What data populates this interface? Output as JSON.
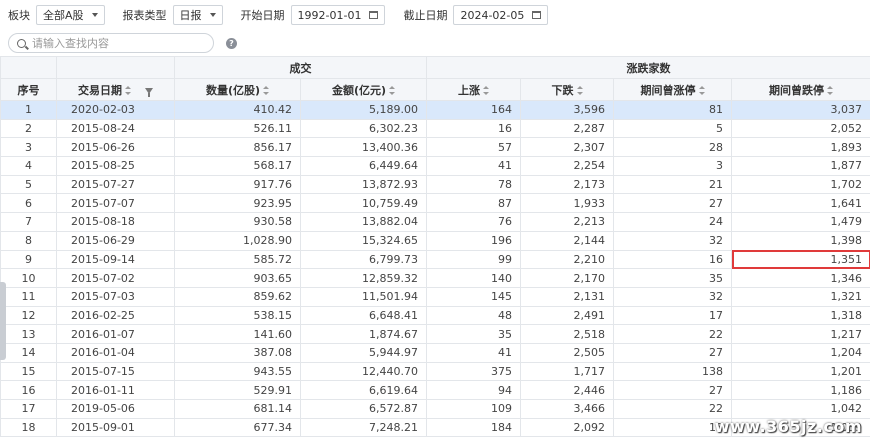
{
  "filters": {
    "board_label": "板块",
    "board_value": "全部A股",
    "report_type_label": "报表类型",
    "report_type_value": "日报",
    "start_label": "开始日期",
    "start_value": "1992-01-01",
    "end_label": "截止日期",
    "end_value": "2024-02-05"
  },
  "search": {
    "placeholder": "请输入查找内容",
    "value": ""
  },
  "help_glyph": "?",
  "headers": {
    "group_trade": "成交",
    "group_updown": "涨跌家数",
    "idx": "序号",
    "date": "交易日期",
    "volume": "数量(亿股)",
    "amount": "金额(亿元)",
    "up": "上涨",
    "down": "下跌",
    "limit_up": "期间曾涨停",
    "limit_down": "期间曾跌停"
  },
  "rows": [
    {
      "idx": "1",
      "date": "2020-02-03",
      "volume": "410.42",
      "amount": "5,189.00",
      "up": "164",
      "down": "3,596",
      "limit_up": "81",
      "limit_down": "3,037"
    },
    {
      "idx": "2",
      "date": "2015-08-24",
      "volume": "526.11",
      "amount": "6,302.23",
      "up": "16",
      "down": "2,287",
      "limit_up": "5",
      "limit_down": "2,052"
    },
    {
      "idx": "3",
      "date": "2015-06-26",
      "volume": "856.17",
      "amount": "13,400.36",
      "up": "57",
      "down": "2,307",
      "limit_up": "28",
      "limit_down": "1,893"
    },
    {
      "idx": "4",
      "date": "2015-08-25",
      "volume": "568.17",
      "amount": "6,449.64",
      "up": "41",
      "down": "2,254",
      "limit_up": "3",
      "limit_down": "1,877"
    },
    {
      "idx": "5",
      "date": "2015-07-27",
      "volume": "917.76",
      "amount": "13,872.93",
      "up": "78",
      "down": "2,173",
      "limit_up": "21",
      "limit_down": "1,702"
    },
    {
      "idx": "6",
      "date": "2015-07-07",
      "volume": "923.95",
      "amount": "10,759.49",
      "up": "87",
      "down": "1,933",
      "limit_up": "27",
      "limit_down": "1,641"
    },
    {
      "idx": "7",
      "date": "2015-08-18",
      "volume": "930.58",
      "amount": "13,882.04",
      "up": "76",
      "down": "2,213",
      "limit_up": "24",
      "limit_down": "1,479"
    },
    {
      "idx": "8",
      "date": "2015-06-29",
      "volume": "1,028.90",
      "amount": "15,324.65",
      "up": "196",
      "down": "2,144",
      "limit_up": "32",
      "limit_down": "1,398"
    },
    {
      "idx": "9",
      "date": "2015-09-14",
      "volume": "585.72",
      "amount": "6,799.73",
      "up": "99",
      "down": "2,210",
      "limit_up": "16",
      "limit_down": "1,351"
    },
    {
      "idx": "10",
      "date": "2015-07-02",
      "volume": "903.65",
      "amount": "12,859.32",
      "up": "140",
      "down": "2,170",
      "limit_up": "35",
      "limit_down": "1,346"
    },
    {
      "idx": "11",
      "date": "2015-07-03",
      "volume": "859.62",
      "amount": "11,501.94",
      "up": "145",
      "down": "2,131",
      "limit_up": "32",
      "limit_down": "1,321"
    },
    {
      "idx": "12",
      "date": "2016-02-25",
      "volume": "538.15",
      "amount": "6,648.41",
      "up": "48",
      "down": "2,491",
      "limit_up": "17",
      "limit_down": "1,318"
    },
    {
      "idx": "13",
      "date": "2016-01-07",
      "volume": "141.60",
      "amount": "1,874.67",
      "up": "35",
      "down": "2,518",
      "limit_up": "22",
      "limit_down": "1,217"
    },
    {
      "idx": "14",
      "date": "2016-01-04",
      "volume": "387.08",
      "amount": "5,944.97",
      "up": "41",
      "down": "2,505",
      "limit_up": "27",
      "limit_down": "1,204"
    },
    {
      "idx": "15",
      "date": "2015-07-15",
      "volume": "943.55",
      "amount": "12,440.70",
      "up": "375",
      "down": "1,717",
      "limit_up": "138",
      "limit_down": "1,201"
    },
    {
      "idx": "16",
      "date": "2016-01-11",
      "volume": "529.91",
      "amount": "6,619.64",
      "up": "94",
      "down": "2,446",
      "limit_up": "27",
      "limit_down": "1,186"
    },
    {
      "idx": "17",
      "date": "2019-05-06",
      "volume": "681.14",
      "amount": "6,572.87",
      "up": "109",
      "down": "3,466",
      "limit_up": "22",
      "limit_down": "1,042"
    },
    {
      "idx": "18",
      "date": "2015-09-01",
      "volume": "677.34",
      "amount": "7,248.21",
      "up": "184",
      "down": "2,092",
      "limit_up": "13",
      "limit_down": "1,039"
    }
  ],
  "selected_row": 0,
  "highlighted_cell": {
    "row": 8,
    "column": "limit_down"
  },
  "watermark": "www.365jz.com",
  "colors": {
    "selected_row_bg": "#d9e8fb",
    "highlight_border": "#e03a3a",
    "header_bg": "#f4f6f9"
  }
}
